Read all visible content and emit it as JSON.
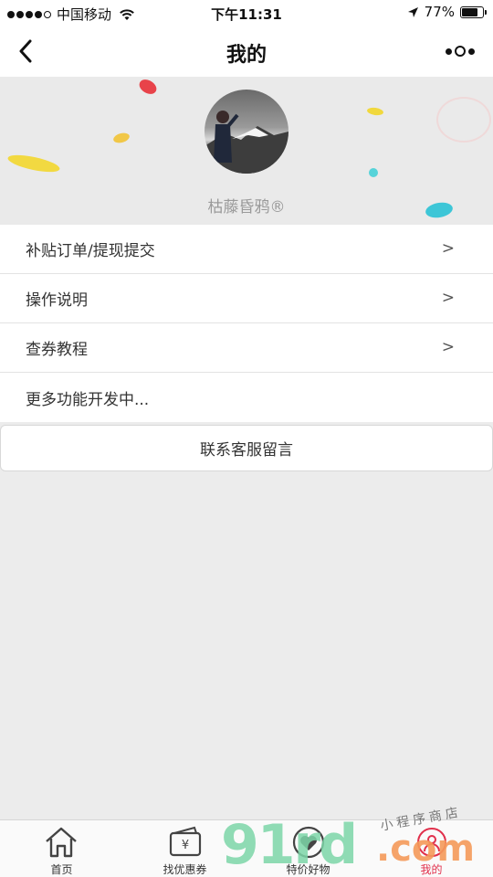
{
  "status_bar": {
    "carrier": "中国移动",
    "time": "下午11:31",
    "battery_percent": "77%",
    "battery_level": 0.77,
    "icons": [
      "signal-dots-icon",
      "wifi-icon",
      "location-arrow-icon",
      "battery-icon"
    ]
  },
  "nav": {
    "title": "我的",
    "back_icon": "back-chevron-icon",
    "more_icon": "more-dots-icon"
  },
  "profile": {
    "username": "枯藤昏鸦®",
    "avatar_icon": "avatar-photo"
  },
  "menu": {
    "items": [
      {
        "label": "补贴订单/提现提交",
        "arrow": ">"
      },
      {
        "label": "操作说明",
        "arrow": ">"
      },
      {
        "label": "查券教程",
        "arrow": ">"
      },
      {
        "label": "更多功能开发中...",
        "arrow": ""
      }
    ]
  },
  "contact_button": {
    "label": "联系客服留言"
  },
  "tab_bar": {
    "tabs": [
      {
        "label": "首页",
        "icon": "home-icon",
        "active": false
      },
      {
        "label": "找优惠券",
        "icon": "coupon-icon",
        "active": false
      },
      {
        "label": "特价好物",
        "icon": "heart-icon",
        "active": false
      },
      {
        "label": "我的",
        "icon": "user-icon",
        "active": true
      }
    ],
    "active_color": "#e1304c"
  },
  "watermark": {
    "brand_number": "91",
    "brand_letters": "rd",
    "domain": ".com",
    "slogan": "小程序商店"
  },
  "colors": {
    "page_background": "#ececec",
    "header_background": "#eaeaea",
    "text": "#333333",
    "muted_text": "#9a9a9a"
  }
}
